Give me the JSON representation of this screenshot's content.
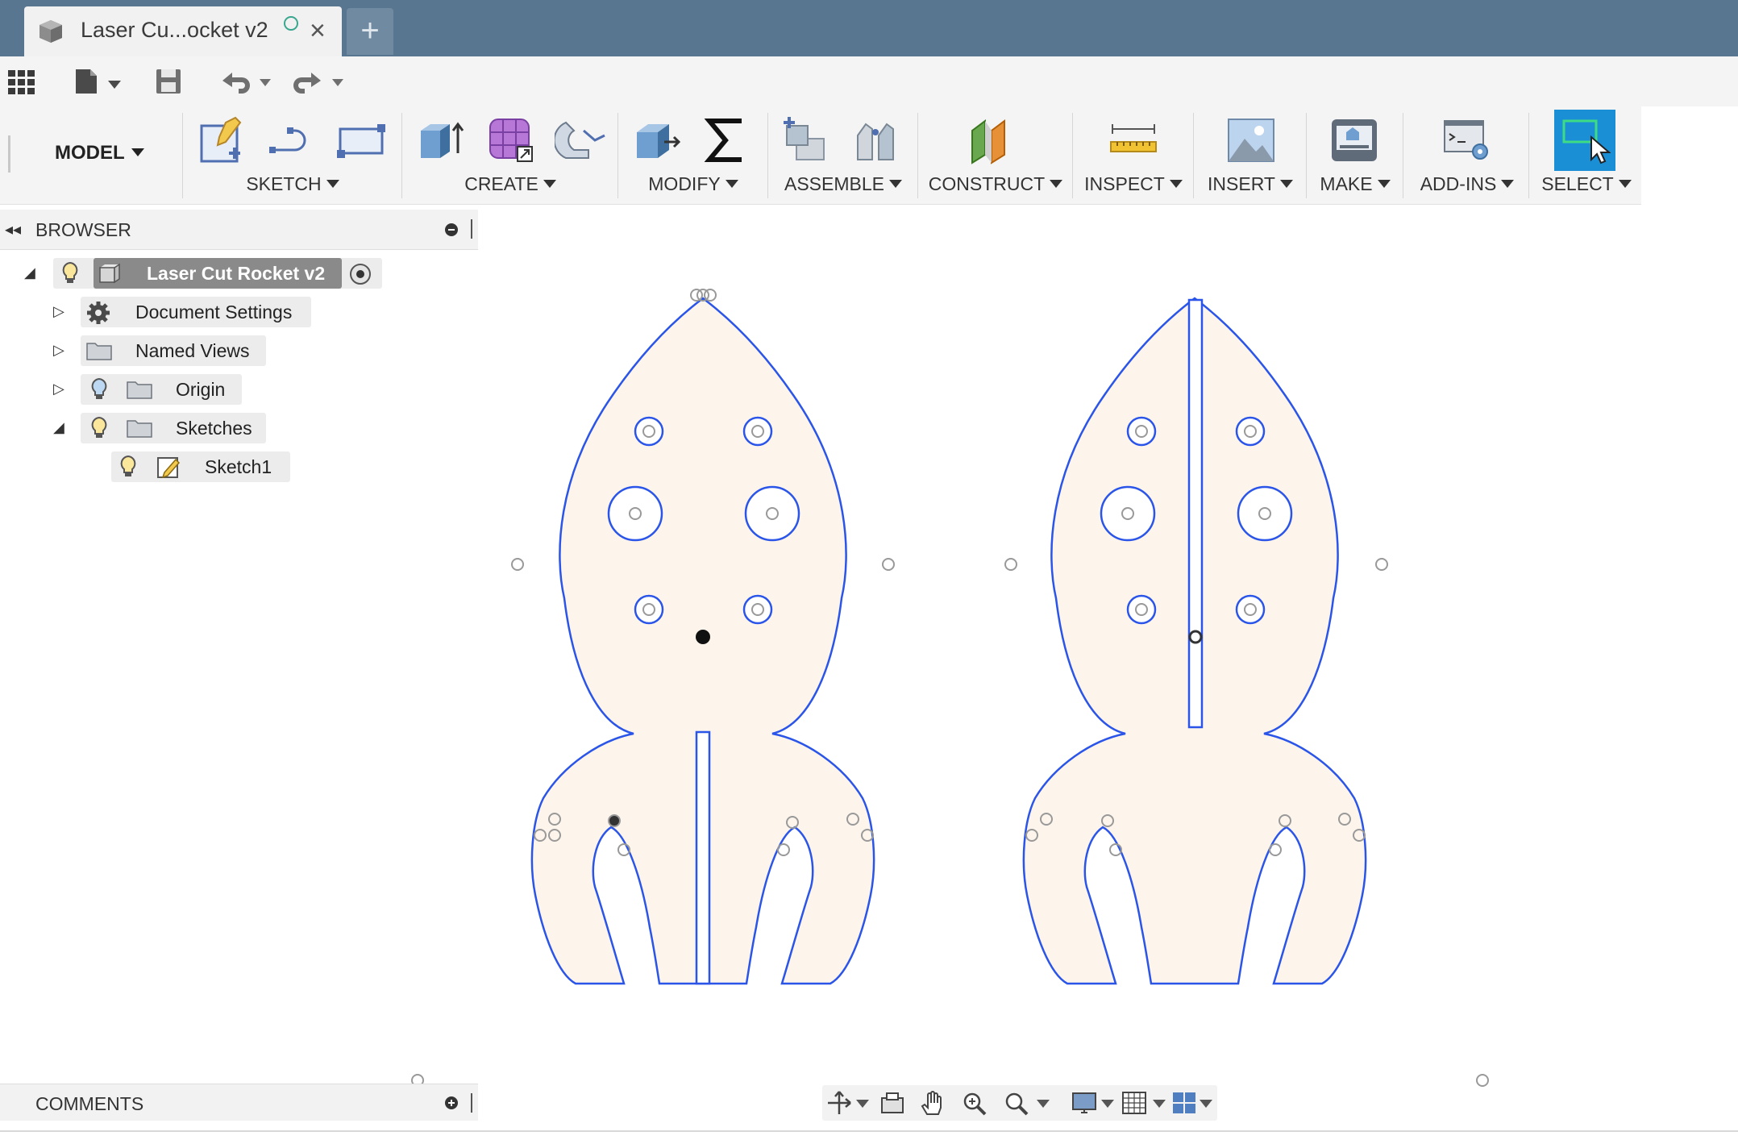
{
  "app": {
    "tab_title": "Laser Cu...ocket v2",
    "new_tab_symbol": "+"
  },
  "toolbar": {
    "workspace": "MODEL",
    "groups": {
      "sketch": "SKETCH",
      "create": "CREATE",
      "modify": "MODIFY",
      "assemble": "ASSEMBLE",
      "construct": "CONSTRUCT",
      "inspect": "INSPECT",
      "insert": "INSERT",
      "make": "MAKE",
      "addins": "ADD-INS",
      "select": "SELECT"
    }
  },
  "browser": {
    "title": "BROWSER",
    "root": "Laser Cut Rocket v2",
    "items": [
      {
        "label": "Document Settings",
        "icon": "gear-icon"
      },
      {
        "label": "Named Views",
        "icon": "folder-icon"
      },
      {
        "label": "Origin",
        "icon": "folder-icon"
      },
      {
        "label": "Sketches",
        "icon": "folder-icon"
      },
      {
        "label": "Sketch1",
        "icon": "sketch-icon"
      }
    ]
  },
  "comments": {
    "title": "COMMENTS"
  },
  "colors": {
    "titlebar": "#587690",
    "sketch_stroke": "#2a55e8",
    "sketch_fill": "#fdf5ec",
    "select_accent": "#1a8fd6"
  },
  "canvas": {
    "pieces": [
      "rocket-left",
      "rocket-right"
    ]
  }
}
